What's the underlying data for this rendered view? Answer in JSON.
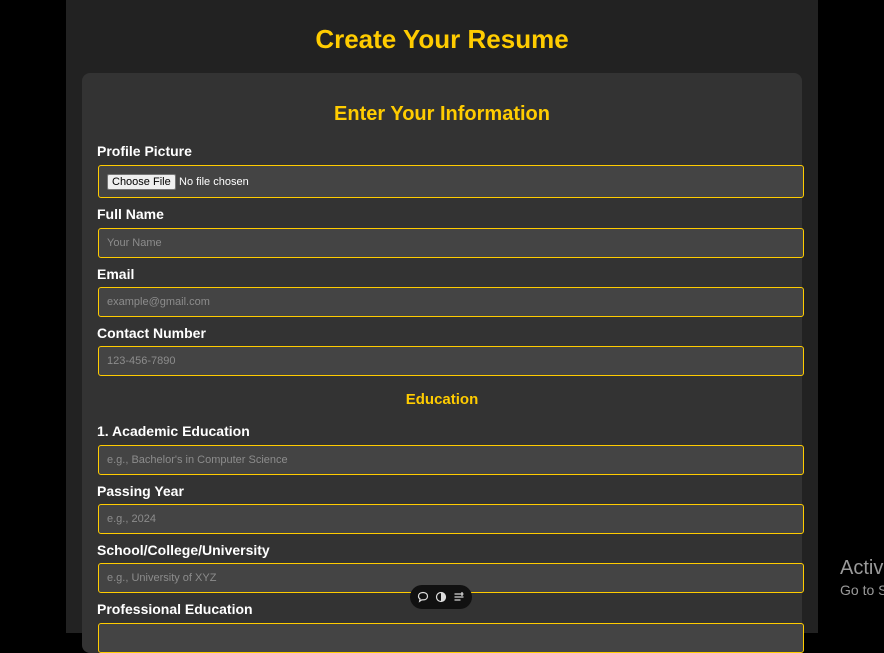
{
  "page": {
    "title": "Create Your Resume"
  },
  "form": {
    "heading": "Enter Your Information",
    "profile_picture": {
      "label": "Profile Picture",
      "button_label": "Choose File",
      "status": "No file chosen"
    },
    "full_name": {
      "label": "Full Name",
      "placeholder": "Your Name"
    },
    "email": {
      "label": "Email",
      "placeholder": "example@gmail.com"
    },
    "contact_number": {
      "label": "Contact Number",
      "placeholder": "123-456-7890"
    },
    "education": {
      "heading": "Education",
      "academic": {
        "label": "1. Academic Education",
        "placeholder": "e.g., Bachelor's in Computer Science"
      },
      "passing_year": {
        "label": "Passing Year",
        "placeholder": "e.g., 2024"
      },
      "institution": {
        "label": "School/College/University",
        "placeholder": "e.g., University of XYZ"
      },
      "professional": {
        "label": "Professional Education",
        "placeholder": ""
      }
    }
  },
  "toolbar": {
    "icons": [
      "comment-icon",
      "contrast-icon",
      "menu-icon"
    ]
  },
  "os_overlay": {
    "line1": "Activ",
    "line2": "Go to S"
  },
  "colors": {
    "accent": "#ffcc00",
    "page_bg": "#222222",
    "card_bg": "#333333",
    "field_bg": "#444444"
  }
}
